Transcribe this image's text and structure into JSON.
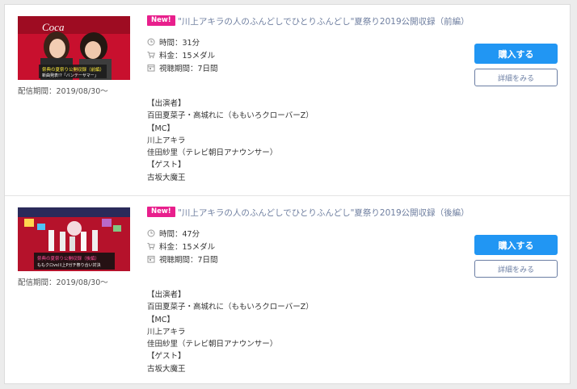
{
  "episodes": [
    {
      "badge": "New!",
      "title": "\"川上アキラの人のふんどしでひとりふんどし\"夏祭り2019公開収録（前編）",
      "delivery": "配信期間：2019/08/30〜",
      "duration": "時間：31分",
      "price": "料金：15メダル",
      "viewing_period": "視聴期間：7日間",
      "cast": [
        "【出演者】",
        "百田夏菜子・高城れに（ももいろクローバーZ）",
        "【MC】",
        "川上アキラ",
        "佳田紗里（テレビ朝日アナウンサー）",
        "【ゲスト】",
        "古坂大魔王"
      ],
      "buy_label": "購入する",
      "details_label": "詳細をみる",
      "thumb_caption_1": "祭典の夏祭り公開収録（前編）",
      "thumb_caption_2": "新曲発表!?「バンテーサマー」"
    },
    {
      "badge": "New!",
      "title": "\"川上アキラの人のふんどしでひとりふんどし\"夏祭り2019公開収録（後編）",
      "delivery": "配信期間：2019/08/30〜",
      "duration": "時間：47分",
      "price": "料金：15メダル",
      "viewing_period": "視聴期間：7日間",
      "cast": [
        "【出演者】",
        "百田夏菜子・高城れに（ももいろクローバーZ）",
        "【MC】",
        "川上アキラ",
        "佳田紗里（テレビ朝日アナウンサー）",
        "【ゲスト】",
        "古坂大魔王"
      ],
      "buy_label": "購入する",
      "details_label": "詳細をみる",
      "thumb_caption_1": "祭典の夏祭り公開収録（後編）",
      "thumb_caption_2": "ももクロvs川上Pガチ祭り合い対決"
    }
  ],
  "colors": {
    "badge": "#e81f8c",
    "title": "#6f7fa0",
    "buy": "#2196f3",
    "details_border": "#6b7ea3"
  },
  "icons": [
    "clock-icon",
    "cart-icon",
    "calendar-icon"
  ]
}
